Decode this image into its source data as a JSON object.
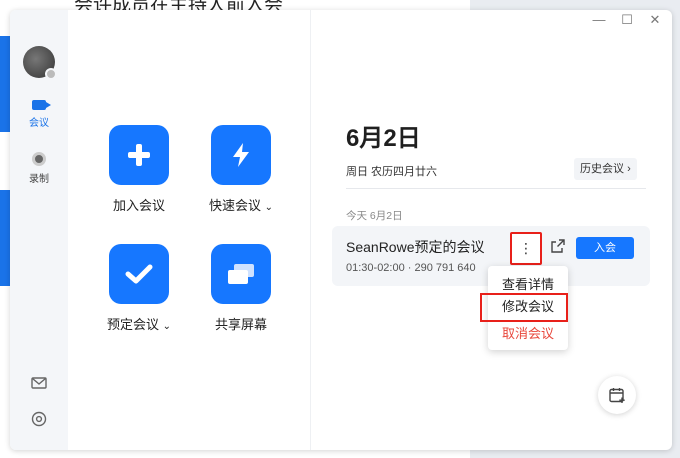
{
  "background_window": {
    "text": "会许成员在主持人前入会"
  },
  "window_controls": {
    "minimize": "—",
    "maximize": "☐",
    "close": "✕"
  },
  "sidebar": {
    "items": [
      {
        "label": "会议",
        "icon": "video-camera-icon",
        "active": true
      },
      {
        "label": "录制",
        "icon": "record-icon",
        "active": false
      }
    ],
    "bottom_icons": [
      "mail-icon",
      "settings-icon"
    ]
  },
  "actions": {
    "join": "加入会议",
    "quick": "快速会议",
    "schedule": "预定会议",
    "share": "共享屏幕"
  },
  "header": {
    "date": "6月2日",
    "weekday_lunar": "周日 农历四月廿六",
    "history_button": "历史会议"
  },
  "section": {
    "today_label": "今天 6月2日"
  },
  "meeting": {
    "title": "SeanRowe预定的会议",
    "time_id": "01:30-02:00 · 290 791 640",
    "more": "⋮",
    "join_button": "入会"
  },
  "context_menu": {
    "items": [
      {
        "label": "查看详情"
      },
      {
        "label": "修改会议"
      },
      {
        "label": "取消会议"
      }
    ]
  },
  "colors": {
    "accent": "#1677ff",
    "danger": "#e8473c",
    "highlight": "#e8201a"
  }
}
